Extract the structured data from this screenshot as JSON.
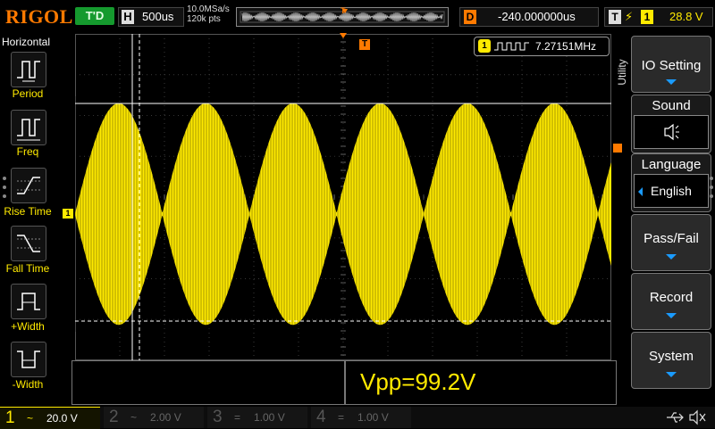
{
  "brand": "RIGOL",
  "status": {
    "run_state": "T'D",
    "horizontal": {
      "label": "H",
      "timebase": "500us"
    },
    "sample_rate": "10.0MSa/s",
    "memory_depth": "120k pts",
    "memory_trigger_marker": "T",
    "delay": {
      "label": "D",
      "value": "-240.000000us"
    },
    "trigger": {
      "label": "T",
      "edge_icon": "rising-edge-icon",
      "source": "1",
      "level": "28.8 V"
    }
  },
  "left_menu": {
    "title": "Horizontal",
    "items": [
      {
        "label": "Period",
        "icon": "period-icon"
      },
      {
        "label": "Freq",
        "icon": "frequency-icon"
      },
      {
        "label": "Rise Time",
        "icon": "rise-time-icon"
      },
      {
        "label": "Fall Time",
        "icon": "fall-time-icon"
      },
      {
        "label": "+Width",
        "icon": "positive-width-icon"
      },
      {
        "label": "-Width",
        "icon": "negative-width-icon"
      }
    ]
  },
  "waveform": {
    "color": "#ffea00",
    "channel_marker": "1",
    "trigger_marker": "T",
    "frequency_readout": {
      "channel": "1",
      "value": "7.27151MHz"
    }
  },
  "right_menu": {
    "tab_label": "Utility",
    "items": [
      {
        "label": "IO Setting"
      },
      {
        "label": "Sound",
        "icon": "speaker-icon"
      },
      {
        "label": "Language",
        "value": "English"
      },
      {
        "label": "Pass/Fail"
      },
      {
        "label": "Record"
      },
      {
        "label": "System"
      }
    ]
  },
  "measurement": {
    "text": "Vpp=99.2V"
  },
  "channels": [
    {
      "num": "1",
      "coupling": "~",
      "scale": "20.0 V",
      "color": "#ffea00",
      "active": true
    },
    {
      "num": "2",
      "coupling": "~",
      "scale": "2.00 V",
      "color": "#00c8ff",
      "active": false
    },
    {
      "num": "3",
      "coupling": "=",
      "scale": "1.00 V",
      "color": "#ff3cff",
      "active": false
    },
    {
      "num": "4",
      "coupling": "=",
      "scale": "1.00 V",
      "color": "#2b6bff",
      "active": false
    }
  ]
}
